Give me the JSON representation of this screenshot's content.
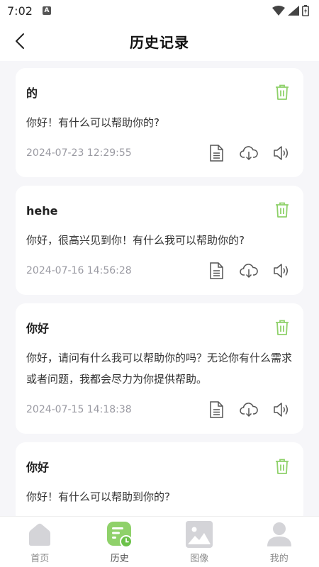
{
  "status_bar": {
    "time": "7:02",
    "notif_letter": "A"
  },
  "header": {
    "title": "历史记录"
  },
  "records": [
    {
      "title": "的",
      "text": "你好！有什么可以帮助你的?",
      "time": "2024-07-23 12:29:55"
    },
    {
      "title": "hehe",
      "text": "你好，很高兴见到你！有什么我可以帮助你的?",
      "time": "2024-07-16 14:56:28"
    },
    {
      "title": "你好",
      "text": "你好，请问有什么我可以帮助你的吗？无论你有什么需求或者问题，我都会尽力为你提供帮助。",
      "time": "2024-07-15 14:18:38"
    },
    {
      "title": "你好",
      "text": "你好！有什么可以帮助到你的?",
      "time": ""
    }
  ],
  "tabs": [
    {
      "label": "首页",
      "icon": "home-icon"
    },
    {
      "label": "历史",
      "icon": "history-icon"
    },
    {
      "label": "图像",
      "icon": "image-icon"
    },
    {
      "label": "我的",
      "icon": "profile-icon"
    }
  ],
  "colors": {
    "accent": "#8fd16a",
    "accent_dark": "#6cc24a",
    "inactive": "#d4d4d8"
  }
}
